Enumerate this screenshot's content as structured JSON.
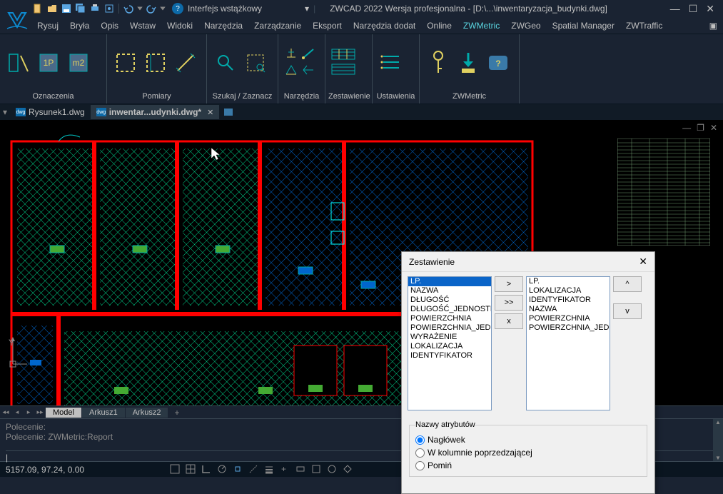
{
  "app": {
    "title": "ZWCAD 2022 Wersja profesjonalna - [D:\\...\\inwentaryzacja_budynki.dwg]",
    "ui_mode_label": "Interfejs wstążkowy"
  },
  "menubar": {
    "items": [
      "Rysuj",
      "Bryła",
      "Opis",
      "Wstaw",
      "Widoki",
      "Narzędzia",
      "Zarządzanie",
      "Eksport",
      "Narzędzia dodat",
      "Online",
      "ZWMetric",
      "ZWGeo",
      "Spatial Manager",
      "ZWTraffic"
    ],
    "active_index": 10
  },
  "ribbon": {
    "panels": [
      {
        "title": "Oznaczenia"
      },
      {
        "title": "Pomiary"
      },
      {
        "title": "Szukaj / Zaznacz"
      },
      {
        "title": "Narzędzia"
      },
      {
        "title": "Zestawienie"
      },
      {
        "title": "Ustawienia"
      },
      {
        "title": "ZWMetric"
      }
    ]
  },
  "doc_tabs": {
    "tabs": [
      {
        "label": "Rysunek1.dwg",
        "active": false
      },
      {
        "label": "inwentar...udynki.dwg*",
        "active": true
      }
    ]
  },
  "layout_tabs": {
    "tabs": [
      "Model",
      "Arkusz1",
      "Arkusz2"
    ],
    "active_index": 0
  },
  "command_line": {
    "lines": [
      "Polecenie:",
      "Polecenie: ZWMetric:Report"
    ],
    "prompt": ""
  },
  "statusbar": {
    "coords": "5157.09, 97.24, 0.00"
  },
  "dialog": {
    "title": "Zestawienie",
    "list_available": [
      "LP.",
      "NAZWA",
      "DŁUGOŚĆ",
      "DŁUGOŚĆ_JEDNOSTK",
      "POWIERZCHNIA",
      "POWIERZCHNIA_JEDN",
      "WYRAŻENIE",
      "LOKALIZACJA",
      "IDENTYFIKATOR"
    ],
    "list_available_selected": 0,
    "list_selected": [
      "LP.",
      "LOKALIZACJA",
      "IDENTYFIKATOR",
      "NAZWA",
      "POWIERZCHNIA",
      "POWIERZCHNIA_JEDN"
    ],
    "btn_add": ">",
    "btn_add_all": ">>",
    "btn_remove": "x",
    "btn_up": "^",
    "btn_down": "v",
    "attr_section_title": "Nazwy atrybutów",
    "radio_header": "Nagłówek",
    "radio_preceding": "W kolumnie poprzedzającej",
    "radio_skip": "Pomiń"
  }
}
